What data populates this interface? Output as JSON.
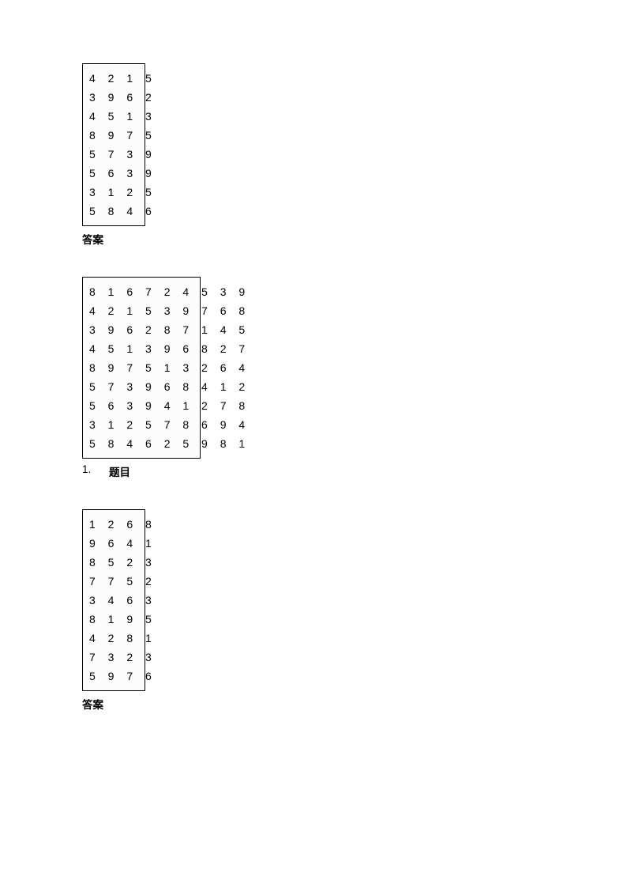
{
  "sections": [
    {
      "type": "grid",
      "width_cells": 4,
      "rows": [
        "4 2 1 5",
        "3 9 6 2",
        "4 5 1 3",
        "8 9 7 5",
        "5 7 3 9",
        "5 6 3 9",
        "3 1 2 5",
        "5 8 4 6"
      ],
      "caption": {
        "kind": "plain",
        "text": "答案"
      }
    },
    {
      "type": "grid",
      "width_cells": 9,
      "rows": [
        "8 1 6 7 2 4 5 3 9",
        "4 2 1 5 3 9 7 6 8",
        "3 9 6 2 8 7 1 4 5",
        "4 5 1 3 9 6 8 2 7",
        "8 9 7 5 1 3 2 6 4",
        "5 7 3 9 6 8 4 1 2",
        "5 6 3 9 4 1 2 7 8",
        "3 1 2 5 7 8 6 9 4",
        "5 8 4 6 2 5 9 8 1"
      ],
      "caption": {
        "kind": "numbered",
        "number": "1.",
        "text": "题目"
      }
    },
    {
      "type": "grid",
      "width_cells": 4,
      "rows": [
        "1 2 6 8",
        "9 6 4 1",
        "8 5 2 3",
        "7 7 5 2",
        "3 4 6 3",
        "8 1 9 5",
        "4 2 8 1",
        "7 3 2 3",
        "5 9 7 6"
      ],
      "caption": {
        "kind": "plain",
        "text": "答案"
      }
    }
  ]
}
